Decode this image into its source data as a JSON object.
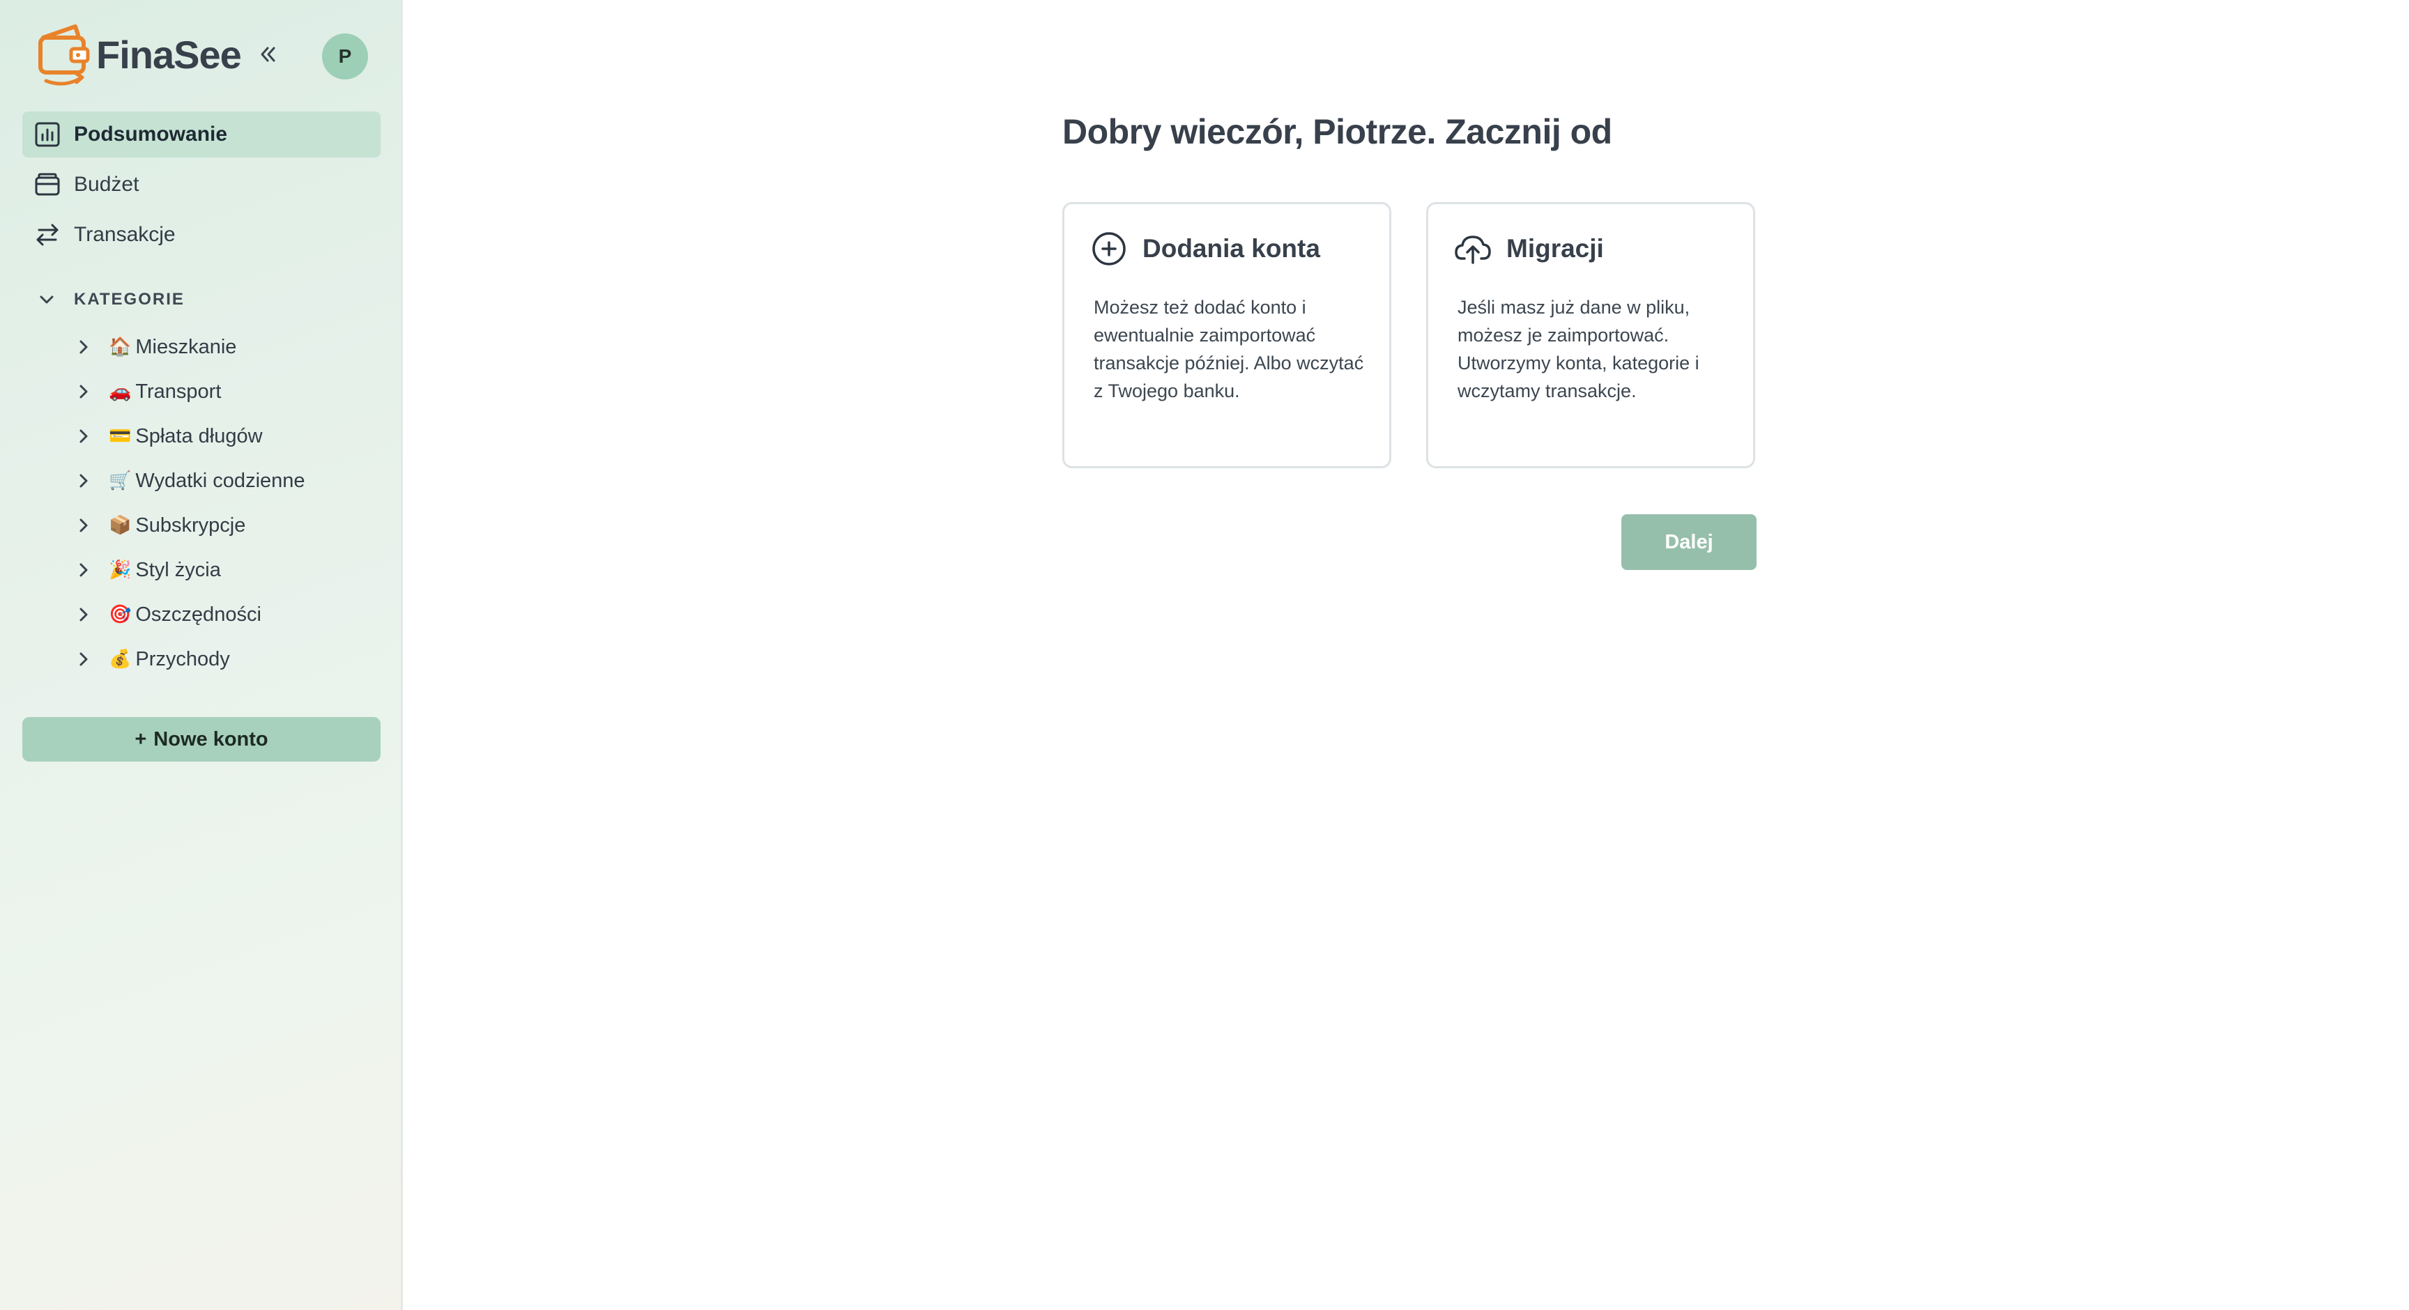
{
  "app": {
    "brand": "FinaSee",
    "accent_color": "#a8d1bd",
    "active_nav_color": "#c5e2d3",
    "logo_color": "#e8832a"
  },
  "header": {
    "collapse_icon": "double-chevron-left-icon",
    "avatar_initial": "P"
  },
  "nav": {
    "items": [
      {
        "label": "Podsumowanie",
        "icon": "bar-chart-icon",
        "active": true
      },
      {
        "label": "Budżet",
        "icon": "wallet-icon",
        "active": false
      },
      {
        "label": "Transakcje",
        "icon": "swap-arrows-icon",
        "active": false
      }
    ]
  },
  "categories": {
    "title": "KATEGORIE",
    "items": [
      {
        "emoji": "🏠",
        "label": "Mieszkanie"
      },
      {
        "emoji": "🚗",
        "label": "Transport"
      },
      {
        "emoji": "💳",
        "label": "Spłata długów"
      },
      {
        "emoji": "🛒",
        "label": "Wydatki codzienne"
      },
      {
        "emoji": "📦",
        "label": "Subskrypcje"
      },
      {
        "emoji": "🎉",
        "label": "Styl życia"
      },
      {
        "emoji": "🎯",
        "label": "Oszczędności"
      },
      {
        "emoji": "💰",
        "label": "Przychody"
      }
    ]
  },
  "sidebar": {
    "new_account_plus": "+",
    "new_account_label": "Nowe konto"
  },
  "main": {
    "greeting": "Dobry wieczór, Piotrze. Zacznij od",
    "cards": [
      {
        "title": "Dodania konta",
        "icon": "plus-circle-icon",
        "text": "Możesz też dodać konto i ewentualnie zaimportować transakcje później. Albo wczytać z Twojego banku."
      },
      {
        "title": "Migracji",
        "icon": "cloud-upload-icon",
        "text": "Jeśli masz już dane w pliku, możesz je zaimportować. Utworzymy konta, kategorie i wczytamy transakcje."
      }
    ],
    "next_label": "Dalej"
  }
}
